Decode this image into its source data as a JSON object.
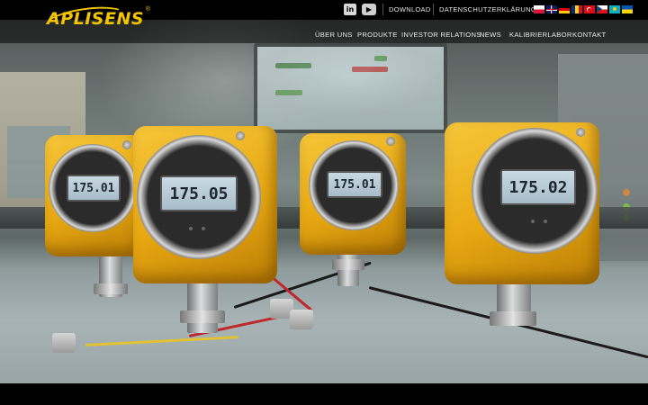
{
  "brand": {
    "logo_text": "APLISENS",
    "registered": "®",
    "color": "#f3c400"
  },
  "social": [
    {
      "name": "linkedin",
      "label": "in"
    },
    {
      "name": "youtube",
      "label": "▶"
    }
  ],
  "top_links": {
    "download": "DOWNLOAD",
    "privacy": "DATENSCHUTZERKLÄRUNG"
  },
  "languages": [
    "pl",
    "en",
    "de",
    "ro",
    "tr",
    "cz",
    "kz",
    "ua"
  ],
  "nav": [
    "ÜBER UNS",
    "PRODUKTE",
    "INVESTOR RELATIONS",
    "NEWS",
    "KALIBRIERLABOR",
    "KONTAKT"
  ],
  "hero": {
    "description_colors": {
      "housing": "#e8a812",
      "background": "#6b7572"
    },
    "displays": [
      "175.01",
      "175.05",
      "175.01",
      "175.02"
    ]
  }
}
